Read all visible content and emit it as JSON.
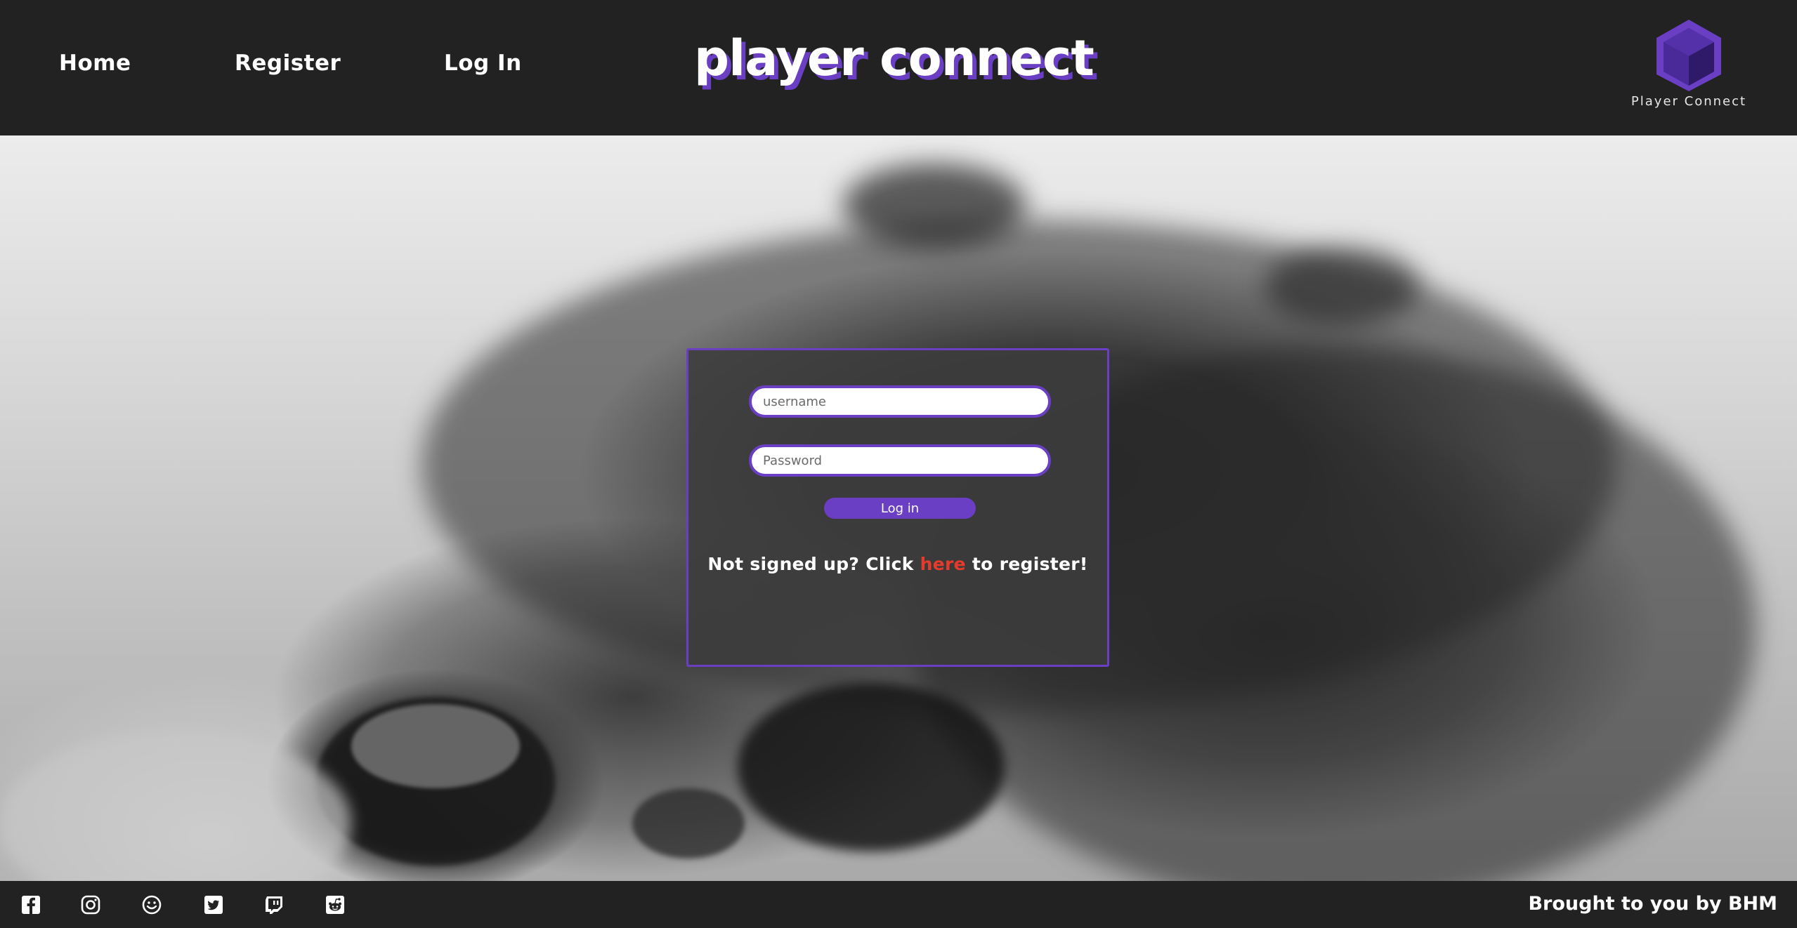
{
  "header": {
    "nav": {
      "home": "Home",
      "register": "Register",
      "login": "Log In"
    },
    "title": "player connect",
    "logo_label": "Player Connect"
  },
  "login_form": {
    "username_placeholder": "username",
    "password_placeholder": "Password",
    "button_label": "Log in",
    "signup_prefix": "Not signed up? Click ",
    "signup_link": "here",
    "signup_suffix": " to register!"
  },
  "footer": {
    "social_icons": [
      "facebook-icon",
      "instagram-icon",
      "smiley-icon",
      "twitter-icon",
      "twitch-icon",
      "reddit-icon"
    ],
    "credit": "Brought to you by BHM"
  },
  "colors": {
    "accent": "#6a3fc4",
    "header_bg": "#222222",
    "link_red": "#e53b2c"
  }
}
